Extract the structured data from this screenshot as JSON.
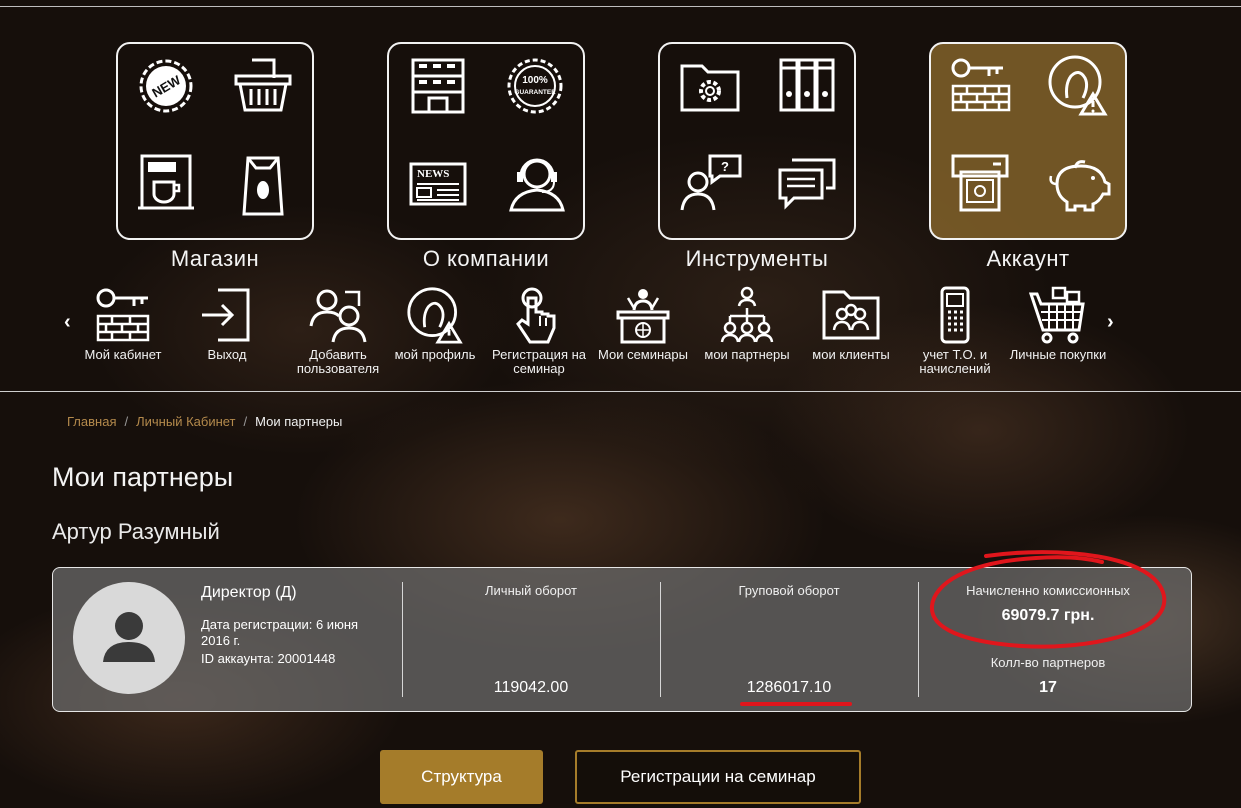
{
  "categories": [
    {
      "label": "Магазин",
      "icons": [
        "new-badge-icon",
        "shopping-basket-icon",
        "coffee-machine-icon",
        "coffee-bag-icon"
      ]
    },
    {
      "label": "О компании",
      "icons": [
        "office-building-icon",
        "guarantee-badge-icon",
        "newspaper-icon",
        "support-operator-icon"
      ]
    },
    {
      "label": "Инструменты",
      "icons": [
        "settings-folder-icon",
        "binders-icon",
        "user-question-icon",
        "chat-bubbles-icon"
      ]
    },
    {
      "label": "Аккаунт",
      "icons": [
        "key-wall-icon",
        "profile-warning-icon",
        "cash-terminal-icon",
        "piggy-bank-icon"
      ]
    }
  ],
  "badge_texts": {
    "new": "NEW",
    "guarantee_top": "100%",
    "guarantee": "GUARANTEE",
    "news": "NEWS"
  },
  "submenu": {
    "items": [
      {
        "label": "Мой кабинет",
        "icon": "key-wall-icon"
      },
      {
        "label": "Выход",
        "icon": "logout-icon"
      },
      {
        "label": "Добавить пользователя",
        "icon": "add-user-icon"
      },
      {
        "label": "мой профиль",
        "icon": "profile-warning-icon"
      },
      {
        "label": "Регистрация на семинар",
        "icon": "pointer-click-icon"
      },
      {
        "label": "Мои семинары",
        "icon": "seminar-podium-icon"
      },
      {
        "label": "мои партнеры",
        "icon": "partners-network-icon"
      },
      {
        "label": "мои клиенты",
        "icon": "clients-folder-icon"
      },
      {
        "label": "учет Т.О. и начислений",
        "icon": "pos-terminal-icon"
      },
      {
        "label": "Личные покупки",
        "icon": "shopping-cart-icon"
      }
    ],
    "prev_arrow": "‹",
    "next_arrow": "›"
  },
  "breadcrumb": {
    "home": "Главная",
    "cabinet": "Личный Кабинет",
    "current": "Мои партнеры",
    "separator": "/"
  },
  "page": {
    "title": "Мои партнеры",
    "user_name": "Артур Разумный"
  },
  "profile": {
    "rank": "Директор (Д)",
    "registration_line1": "Дата регистрации: 6 июня",
    "registration_line2": "2016 г.",
    "account_id": "ID аккаунта: 20001448"
  },
  "stats": {
    "personal_label": "Личный оборот",
    "personal_value": "119042.00",
    "group_label": "Груповой оборот",
    "group_value": "1286017.10",
    "commission_label": "Начисленно комиссионных",
    "commission_value": "69079.7 грн.",
    "partners_label": "Колл-во партнеров",
    "partners_value": "17"
  },
  "buttons": {
    "structure": "Структура",
    "seminar_registrations": "Регистрации на семинар"
  },
  "colors": {
    "accent_gold": "#a57c2a",
    "breadcrumb_link": "#b48a4c",
    "highlight_red": "#e0161c",
    "active_tile": "#8c692d"
  }
}
